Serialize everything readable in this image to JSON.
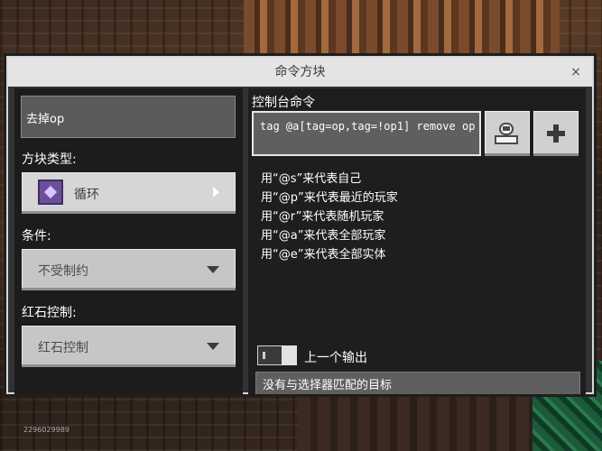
{
  "dialog": {
    "title": "命令方块",
    "close_glyph": "×"
  },
  "left": {
    "name_value": "去掉op",
    "block_type_label": "方块类型:",
    "block_type_value": "循环",
    "condition_label": "条件:",
    "condition_value": "不受制约",
    "redstone_label": "红石控制:",
    "redstone_value": "红石控制"
  },
  "right": {
    "console_label": "控制台命令",
    "command_value": "tag @a[tag=op,tag=!op1] remove op",
    "hints": [
      "用“@s”来代表自己",
      "用“@p”来代表最近的玩家",
      "用“@r”来代表随机玩家",
      "用“@a”来代表全部玩家",
      "用“@e”来代表全部实体"
    ],
    "previous_output_label": "上一个输出",
    "output_text": "没有与选择器匹配的目标"
  },
  "watermark": "2296029989",
  "icons": {
    "command_block": "command-block-icon",
    "output_button": "output-icon",
    "add_button": "plus-icon",
    "dropdown_caret": "chevron-down-icon"
  },
  "colors": {
    "dialog_bg": "#313233",
    "titlebar": "#e4e4e4",
    "panel_bg": "#1c1c1d",
    "dropdown": "#c6c6c6",
    "command_block_purple": "#6c4f9c"
  }
}
